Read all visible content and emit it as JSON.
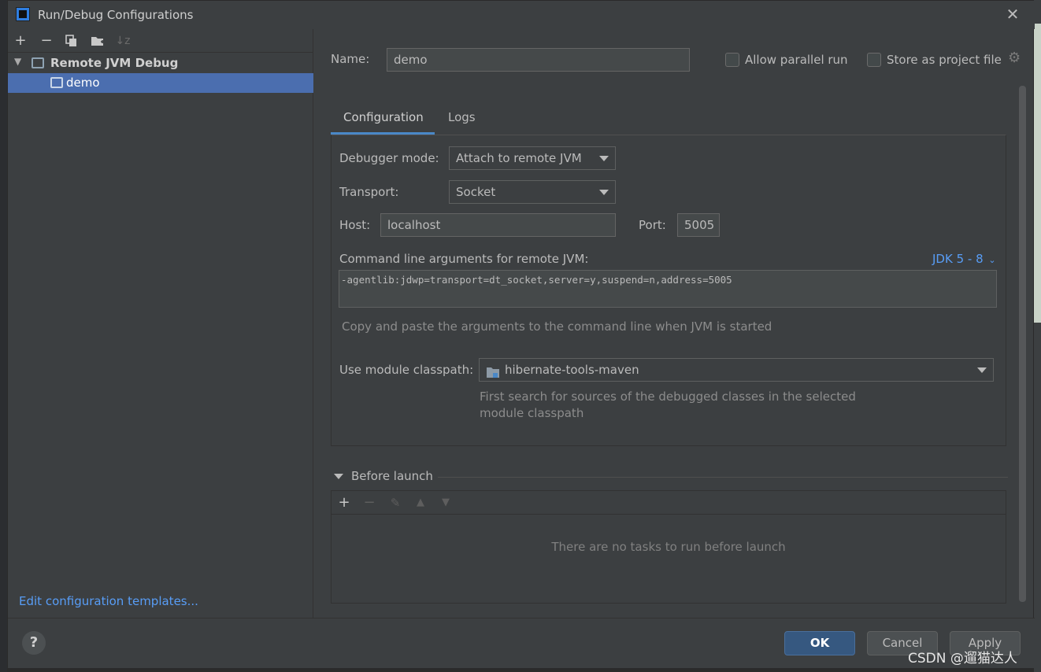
{
  "dialog": {
    "title": "Run/Debug Configurations",
    "close_icon": "close-icon"
  },
  "left_panel": {
    "toolbar": {
      "icons": [
        "add-icon",
        "remove-icon",
        "copy-icon",
        "folder-add-icon",
        "sort-icon"
      ]
    },
    "tree": {
      "group_label": "Remote JVM Debug",
      "selected_item": "demo"
    },
    "edit_templates_link": "Edit configuration templates..."
  },
  "form": {
    "name_label": "Name:",
    "name_value": "demo",
    "allow_parallel_label": "Allow parallel run",
    "store_project_label": "Store as project file",
    "tabs": [
      "Configuration",
      "Logs"
    ],
    "debugger_mode_label": "Debugger mode:",
    "debugger_mode_value": "Attach to remote JVM",
    "transport_label": "Transport:",
    "transport_value": "Socket",
    "host_label": "Host:",
    "host_value": "localhost",
    "port_label": "Port:",
    "port_value": "5005",
    "cmd_args_label": "Command line arguments for remote JVM:",
    "jdk_selector": "JDK 5 - 8",
    "cmd_args_value": "-agentlib:jdwp=transport=dt_socket,server=y,suspend=n,address=5005",
    "cmd_args_hint": "Copy and paste the arguments to the command line when JVM is started",
    "module_classpath_label": "Use module classpath:",
    "module_classpath_value": "hibernate-tools-maven",
    "module_hint_line1": "First search for sources of the debugged classes in the selected",
    "module_hint_line2": "module classpath"
  },
  "before_launch": {
    "title": "Before launch",
    "empty_message": "There are no tasks to run before launch"
  },
  "buttons": {
    "ok": "OK",
    "cancel": "Cancel",
    "apply": "Apply",
    "help": "?"
  },
  "watermark": "CSDN @遛猫达人"
}
